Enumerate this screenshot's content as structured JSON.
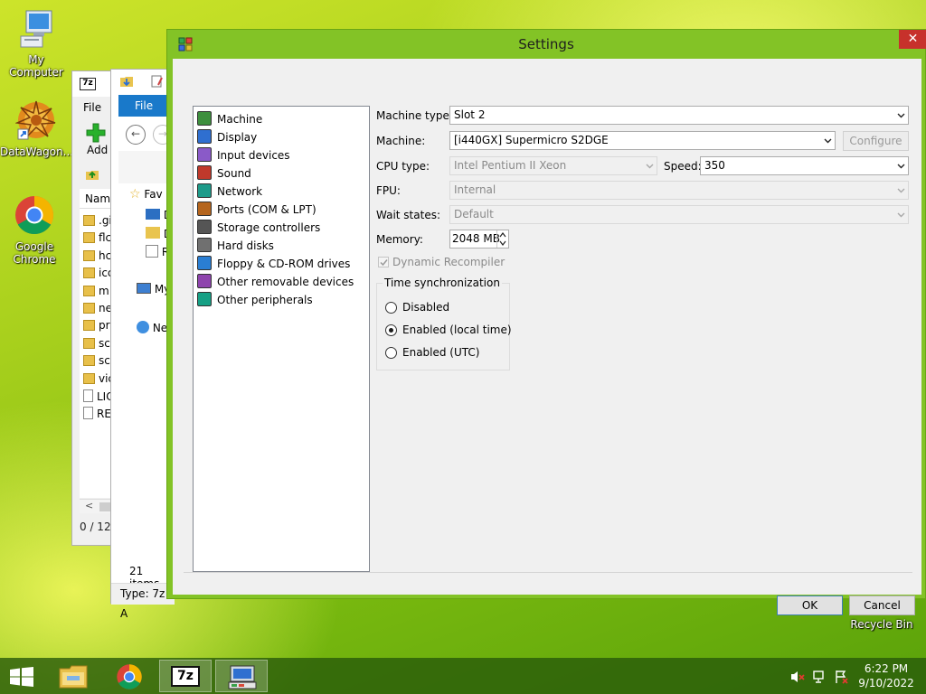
{
  "desktop": {
    "icons": [
      {
        "label": "My Computer",
        "icon": "computer-icon"
      },
      {
        "label": "DataWagon...",
        "icon": "datawagon-icon"
      },
      {
        "label": "Google Chrome",
        "icon": "chrome-icon"
      },
      {
        "label": "Recycle Bin",
        "icon": "recycle-bin-icon"
      }
    ]
  },
  "bg_7z_window": {
    "menu_file": "File",
    "add_label": "Add",
    "column_name": "Nam",
    "items": [
      ".gi",
      "flc",
      "hc",
      "icc",
      "m",
      "ne",
      "pr",
      "sc",
      "sc",
      "vic",
      "LIC",
      "RE"
    ],
    "status": "0 / 12 c"
  },
  "bg_explorer_window": {
    "file_tab": "File",
    "nav_favorites": "Fav",
    "nav_d1": "D",
    "nav_d2": "D",
    "nav_r": "R",
    "nav_mycomputer": "My",
    "nav_network": "Ne",
    "items_count": "21 items",
    "status_type": "Type: 7z A"
  },
  "settings": {
    "title": "Settings",
    "close_glyph": "✕",
    "tree": [
      {
        "label": "Machine",
        "icon": "machine-icon"
      },
      {
        "label": "Display",
        "icon": "display-icon"
      },
      {
        "label": "Input devices",
        "icon": "input-devices-icon"
      },
      {
        "label": "Sound",
        "icon": "sound-icon"
      },
      {
        "label": "Network",
        "icon": "network-icon"
      },
      {
        "label": "Ports (COM & LPT)",
        "icon": "ports-icon"
      },
      {
        "label": "Storage controllers",
        "icon": "storage-controllers-icon"
      },
      {
        "label": "Hard disks",
        "icon": "hard-disks-icon"
      },
      {
        "label": "Floppy & CD-ROM drives",
        "icon": "floppy-cdrom-icon"
      },
      {
        "label": "Other removable devices",
        "icon": "removable-devices-icon"
      },
      {
        "label": "Other peripherals",
        "icon": "peripherals-icon"
      }
    ],
    "machine_type_label": "Machine type:",
    "machine_type_value": "Slot 2",
    "machine_label": "Machine:",
    "machine_value": "[i440GX] Supermicro S2DGE",
    "configure_label": "Configure",
    "cpu_type_label": "CPU type:",
    "cpu_type_value": "Intel Pentium II Xeon",
    "speed_label": "Speed:",
    "speed_value": "350",
    "fpu_label": "FPU:",
    "fpu_value": "Internal",
    "wait_states_label": "Wait states:",
    "wait_states_value": "Default",
    "memory_label": "Memory:",
    "memory_value": "2048 MB",
    "dynarec_label": "Dynamic Recompiler",
    "dynarec_checked": true,
    "time_sync_label": "Time synchronization",
    "time_sync_options": [
      "Disabled",
      "Enabled (local time)",
      "Enabled (UTC)"
    ],
    "time_sync_selected": "Enabled (local time)",
    "ok_label": "OK",
    "cancel_label": "Cancel"
  },
  "taskbar": {
    "clock_time": "6:22 PM",
    "clock_date": "9/10/2022",
    "pinned": [
      "file-explorer-icon",
      "chrome-icon",
      "7zip-icon",
      "86box-icon"
    ]
  }
}
